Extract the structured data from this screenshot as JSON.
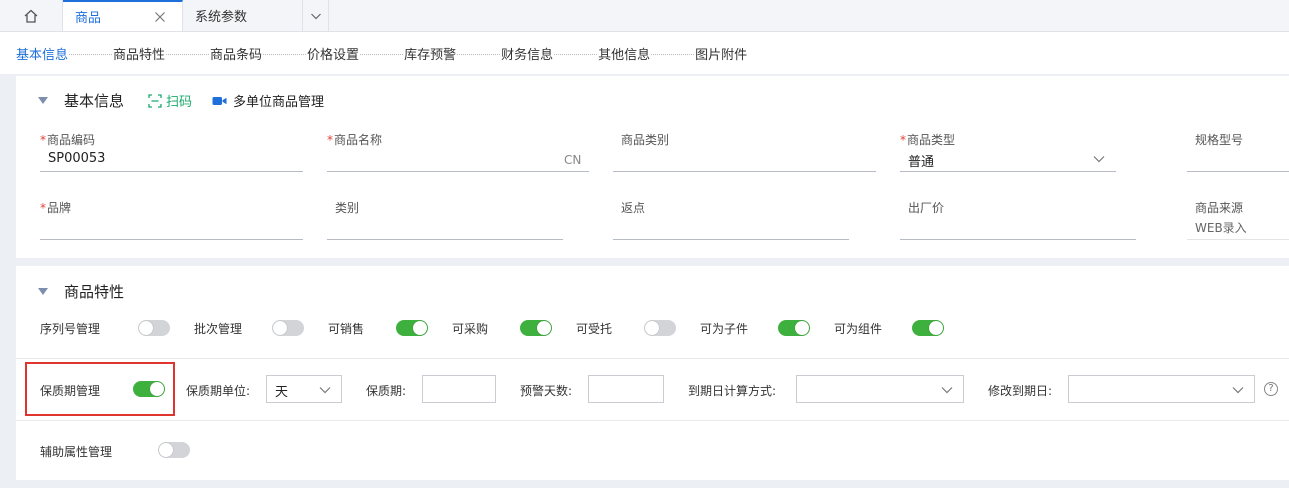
{
  "tabs": {
    "home_icon": "home-icon",
    "items": [
      {
        "label": "商品",
        "active": true
      },
      {
        "label": "系统参数",
        "active": false
      }
    ]
  },
  "section_nav": [
    "基本信息",
    "商品特性",
    "商品条码",
    "价格设置",
    "库存预警",
    "财务信息",
    "其他信息",
    "图片附件"
  ],
  "basic": {
    "title": "基本信息",
    "scan_label": "扫码",
    "multi_unit_label": "多单位商品管理",
    "fields": {
      "code": {
        "label": "商品编码",
        "value": "SP00053"
      },
      "name": {
        "label": "商品名称",
        "value": "",
        "suffix": "CN"
      },
      "category": {
        "label": "商品类别",
        "value": ""
      },
      "type": {
        "label": "商品类型",
        "value": "普通"
      },
      "spec": {
        "label": "规格型号",
        "value": ""
      },
      "brand": {
        "label": "品牌",
        "value": ""
      },
      "class": {
        "label": "类别",
        "value": ""
      },
      "rebate": {
        "label": "返点",
        "value": ""
      },
      "factory_price": {
        "label": "出厂价",
        "value": ""
      },
      "source": {
        "label": "商品来源",
        "value": "WEB录入"
      }
    },
    "required_mark": "*"
  },
  "features": {
    "title": "商品特性",
    "toggles": [
      {
        "label": "序列号管理",
        "on": false
      },
      {
        "label": "批次管理",
        "on": false
      },
      {
        "label": "可销售",
        "on": true
      },
      {
        "label": "可采购",
        "on": true
      },
      {
        "label": "可受托",
        "on": false
      },
      {
        "label": "可为子件",
        "on": true
      },
      {
        "label": "可为组件",
        "on": true
      }
    ],
    "shelf": {
      "label": "保质期管理",
      "on": true,
      "unit_label": "保质期单位:",
      "unit_value": "天",
      "period_label": "保质期:",
      "period_value": "",
      "warn_label": "预警天数:",
      "warn_value": "",
      "calc_label": "到期日计算方式:",
      "calc_value": "",
      "modify_label": "修改到期日:",
      "modify_value": "",
      "help": "?"
    },
    "aux": {
      "label": "辅助属性管理",
      "on": false
    }
  },
  "colors": {
    "accent": "#1e6fd9",
    "toggle_on": "#3eb03e",
    "required": "#e0413b",
    "highlight": "#e0342f",
    "scan": "#1aaa6b"
  }
}
